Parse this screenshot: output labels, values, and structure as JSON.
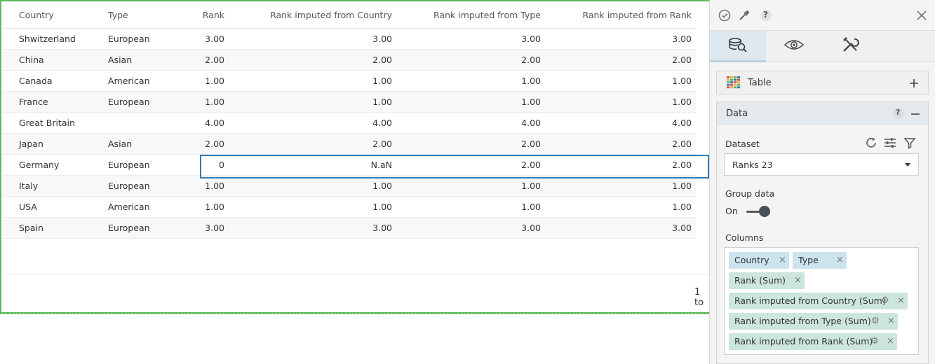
{
  "table": {
    "headers": {
      "country": "Country",
      "type": "Type",
      "rank": "Rank",
      "rank_country": "Rank imputed from Country",
      "rank_type": "Rank imputed from Type",
      "rank_rank": "Rank imputed from Rank"
    },
    "rows": [
      {
        "country": "Shwitzerland",
        "type": "European",
        "rank": "3.00",
        "rank_country": "3.00",
        "rank_type": "3.00",
        "rank_rank": "3.00"
      },
      {
        "country": "China",
        "type": "Asian",
        "rank": "2.00",
        "rank_country": "2.00",
        "rank_type": "2.00",
        "rank_rank": "2.00"
      },
      {
        "country": "Canada",
        "type": "American",
        "rank": "1.00",
        "rank_country": "1.00",
        "rank_type": "1.00",
        "rank_rank": "1.00"
      },
      {
        "country": "France",
        "type": "European",
        "rank": "1.00",
        "rank_country": "1.00",
        "rank_type": "1.00",
        "rank_rank": "1.00"
      },
      {
        "country": "Great Britain",
        "type": "",
        "rank": "4.00",
        "rank_country": "4.00",
        "rank_type": "4.00",
        "rank_rank": "4.00"
      },
      {
        "country": "Japan",
        "type": "Asian",
        "rank": "2.00",
        "rank_country": "2.00",
        "rank_type": "2.00",
        "rank_rank": "2.00"
      },
      {
        "country": "Germany",
        "type": "European",
        "rank": "0",
        "rank_country": "N.aN",
        "rank_type": "2.00",
        "rank_rank": "2.00"
      },
      {
        "country": "Italy",
        "type": "European",
        "rank": "1.00",
        "rank_country": "1.00",
        "rank_type": "1.00",
        "rank_rank": "1.00"
      },
      {
        "country": "USA",
        "type": "American",
        "rank": "1.00",
        "rank_country": "1.00",
        "rank_type": "1.00",
        "rank_rank": "1.00"
      },
      {
        "country": "Spain",
        "type": "European",
        "rank": "3.00",
        "rank_country": "3.00",
        "rank_type": "3.00",
        "rank_rank": "3.00"
      }
    ],
    "pager_text": "1 to"
  },
  "side_panel": {
    "top_icons": [
      "check-circle-icon",
      "eyedropper-icon",
      "help-icon",
      "close-icon"
    ],
    "help_label": "?",
    "tabs": [
      "search-data-icon",
      "eye-icon",
      "tools-icon"
    ],
    "visualization": {
      "label": "Table"
    },
    "data": {
      "title": "Data",
      "help_label": "?",
      "dataset_label": "Dataset",
      "dataset_value": "Ranks 23",
      "group_label": "Group data",
      "group_state": "On",
      "columns_label": "Columns",
      "chips": [
        {
          "label": "Country",
          "kind": "dimension"
        },
        {
          "label": "Type",
          "kind": "dimension"
        },
        {
          "label": "Rank (Sum)",
          "kind": "measure"
        },
        {
          "label": "Rank imputed from Country (Sum)",
          "kind": "measure"
        },
        {
          "label": "Rank imputed from Type  (Sum)",
          "kind": "measure"
        },
        {
          "label": "Rank imputed from Rank (Sum)",
          "kind": "measure"
        }
      ]
    }
  },
  "colors": {
    "panel_border": "#5cb85c",
    "selection": "#337ab7",
    "dimension_chip": "#cde3ee",
    "measure_chip": "#cde6dc",
    "grid_icon": [
      "#d9534f",
      "#f0ad4e",
      "#5cb85c",
      "#337ab7"
    ]
  }
}
